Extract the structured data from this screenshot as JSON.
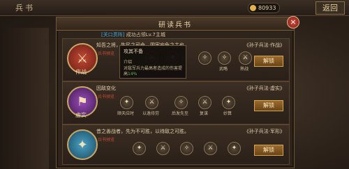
{
  "topbar": {
    "title": "兵书",
    "res1": "80933",
    "back": "返回"
  },
  "panel": {
    "title": "研读兵书",
    "close": "×"
  },
  "quest": {
    "tag": "[关口贯阵]",
    "text": "成功占领Lv.7主城"
  },
  "rows": [
    {
      "medal_label": "作战",
      "sub": "兵书预览",
      "desc": "知吾之将，生民之司命，国家安危之主也。",
      "source": "《孙子兵法·作战》",
      "unlock": "解锁",
      "skills": [
        {
          "label": "",
          "glyph": "⚔"
        },
        {
          "label": "",
          "glyph": "✦"
        },
        {
          "label": "",
          "glyph": "⚔"
        },
        {
          "label": "武略",
          "glyph": "✧"
        },
        {
          "label": "熟战",
          "glyph": "⚔"
        }
      ]
    },
    {
      "medal_label": "虚实",
      "sub": "兵书预览",
      "desc": "因敌变化",
      "source": "《孙子兵法·虚实》",
      "unlock": "解锁",
      "skills": [
        {
          "label": "顺天应时",
          "glyph": "✦"
        },
        {
          "label": "以逸待劳",
          "glyph": "⚔"
        },
        {
          "label": "后发先至",
          "glyph": "✧"
        },
        {
          "label": "复谋",
          "glyph": "⚔"
        },
        {
          "label": "妙算",
          "glyph": "✦"
        }
      ]
    },
    {
      "medal_label": "",
      "sub": "兵书预览",
      "desc": "昔之善战者，先为不可胜，以待敌之可胜。",
      "source": "《孙子兵法·军形》",
      "unlock": "解锁",
      "skills": [
        {
          "label": "",
          "glyph": "✦"
        },
        {
          "label": "",
          "glyph": "⚔"
        },
        {
          "label": "",
          "glyph": "✧"
        },
        {
          "label": "",
          "glyph": "⚔"
        },
        {
          "label": "",
          "glyph": "✦"
        }
      ]
    }
  ],
  "tooltip": {
    "name": "攻其不备",
    "head": "介绍",
    "desc": "对敌军兵力最高者造成的伤害提高",
    "pct": "14%"
  },
  "colors": {
    "red_medal": "#8c2a1f",
    "purple_medal": "#5a2a6e",
    "blue_medal": "#2a6a86"
  }
}
